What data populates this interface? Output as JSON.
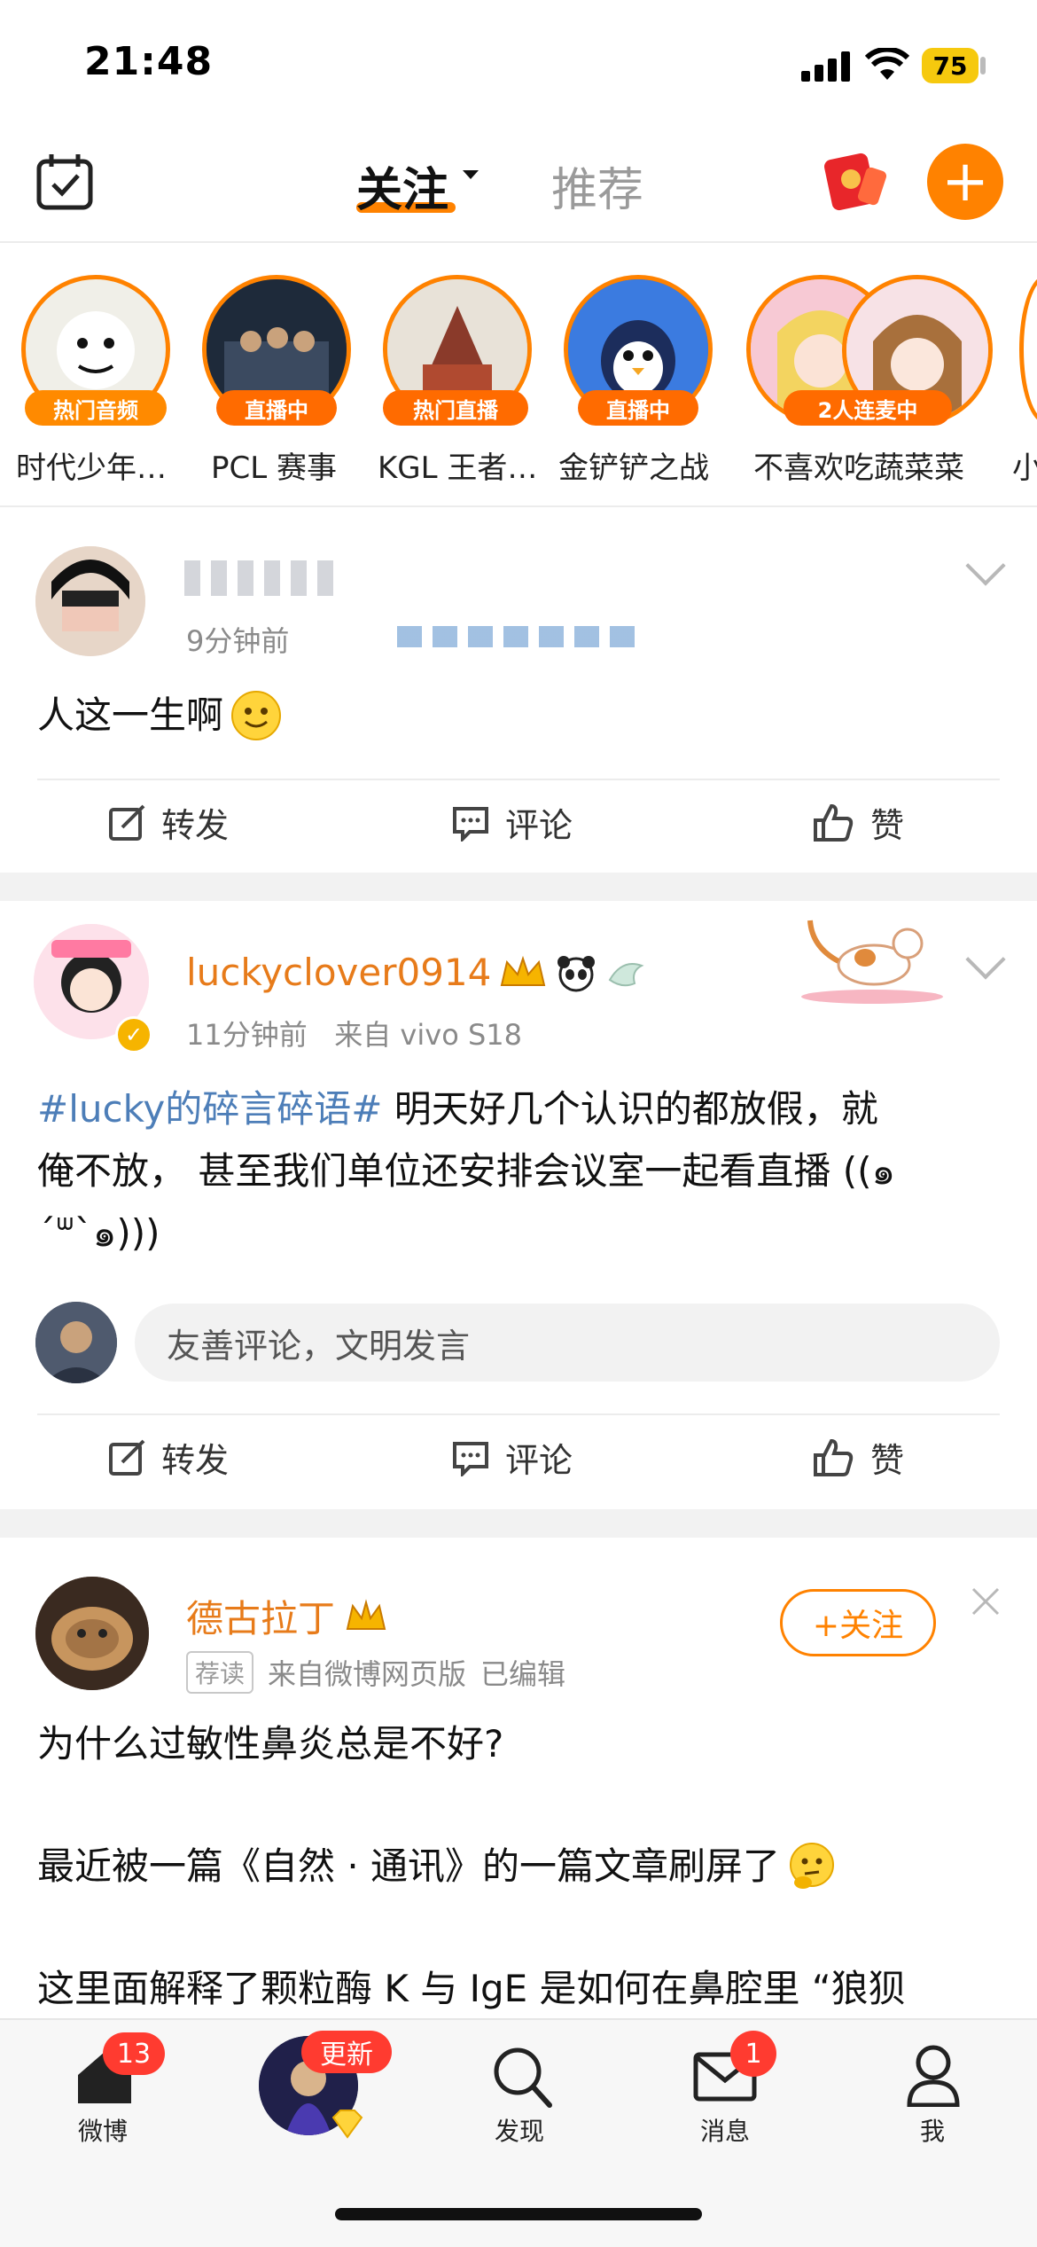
{
  "status": {
    "time": "21:48",
    "battery": "75"
  },
  "header": {
    "tab_follow": "关注",
    "tab_recommend": "推荐"
  },
  "stories": [
    {
      "badge": "热门音频",
      "label": "时代少年…"
    },
    {
      "badge": "直播中",
      "label": "PCL 赛事"
    },
    {
      "badge": "热门直播",
      "label": "KGL 王者…"
    },
    {
      "badge": "直播中",
      "label": "金铲铲之战"
    },
    {
      "badge": "2人连麦中",
      "label": "不喜欢吃蔬菜菜"
    },
    {
      "label": "小"
    }
  ],
  "post1": {
    "time": "9分钟前",
    "text": "人这一生啊",
    "repost": "转发",
    "comment": "评论",
    "like": "赞"
  },
  "post2": {
    "username": "luckyclover0914",
    "time": "11分钟前",
    "source": "来自 vivo S18",
    "hashtag": "#lucky的碎言碎语#",
    "text_line1_rest": " 明天好几个认识的都放假，就",
    "text_line2": "俺不放， 甚至我们单位还安排会议室一起看直播 ((๑",
    "text_line3": "ˊᐜˋ๑)))",
    "comment_placeholder": "友善评论，文明发言",
    "repost": "转发",
    "comment": "评论",
    "like": "赞"
  },
  "post3": {
    "username": "德古拉丁",
    "tag": "荐读",
    "source": "来自微博网页版",
    "edited": "已编辑",
    "follow_button": "+关注",
    "line1": "为什么过敏性鼻炎总是不好?",
    "line2": "最近被一篇《自然 · 通讯》的一篇文章刷屏了",
    "line3": "这里面解释了颗粒酶 K 与 IgE 是如何在鼻腔里 “狼狈"
  },
  "tabbar": {
    "home": "微博",
    "home_badge": "13",
    "update_badge": "更新",
    "discover": "发现",
    "messages": "消息",
    "messages_badge": "1",
    "me": "我"
  },
  "colors": {
    "accent": "#ff8200",
    "link": "#4d7eb8",
    "badge_red": "#ff3b30"
  }
}
